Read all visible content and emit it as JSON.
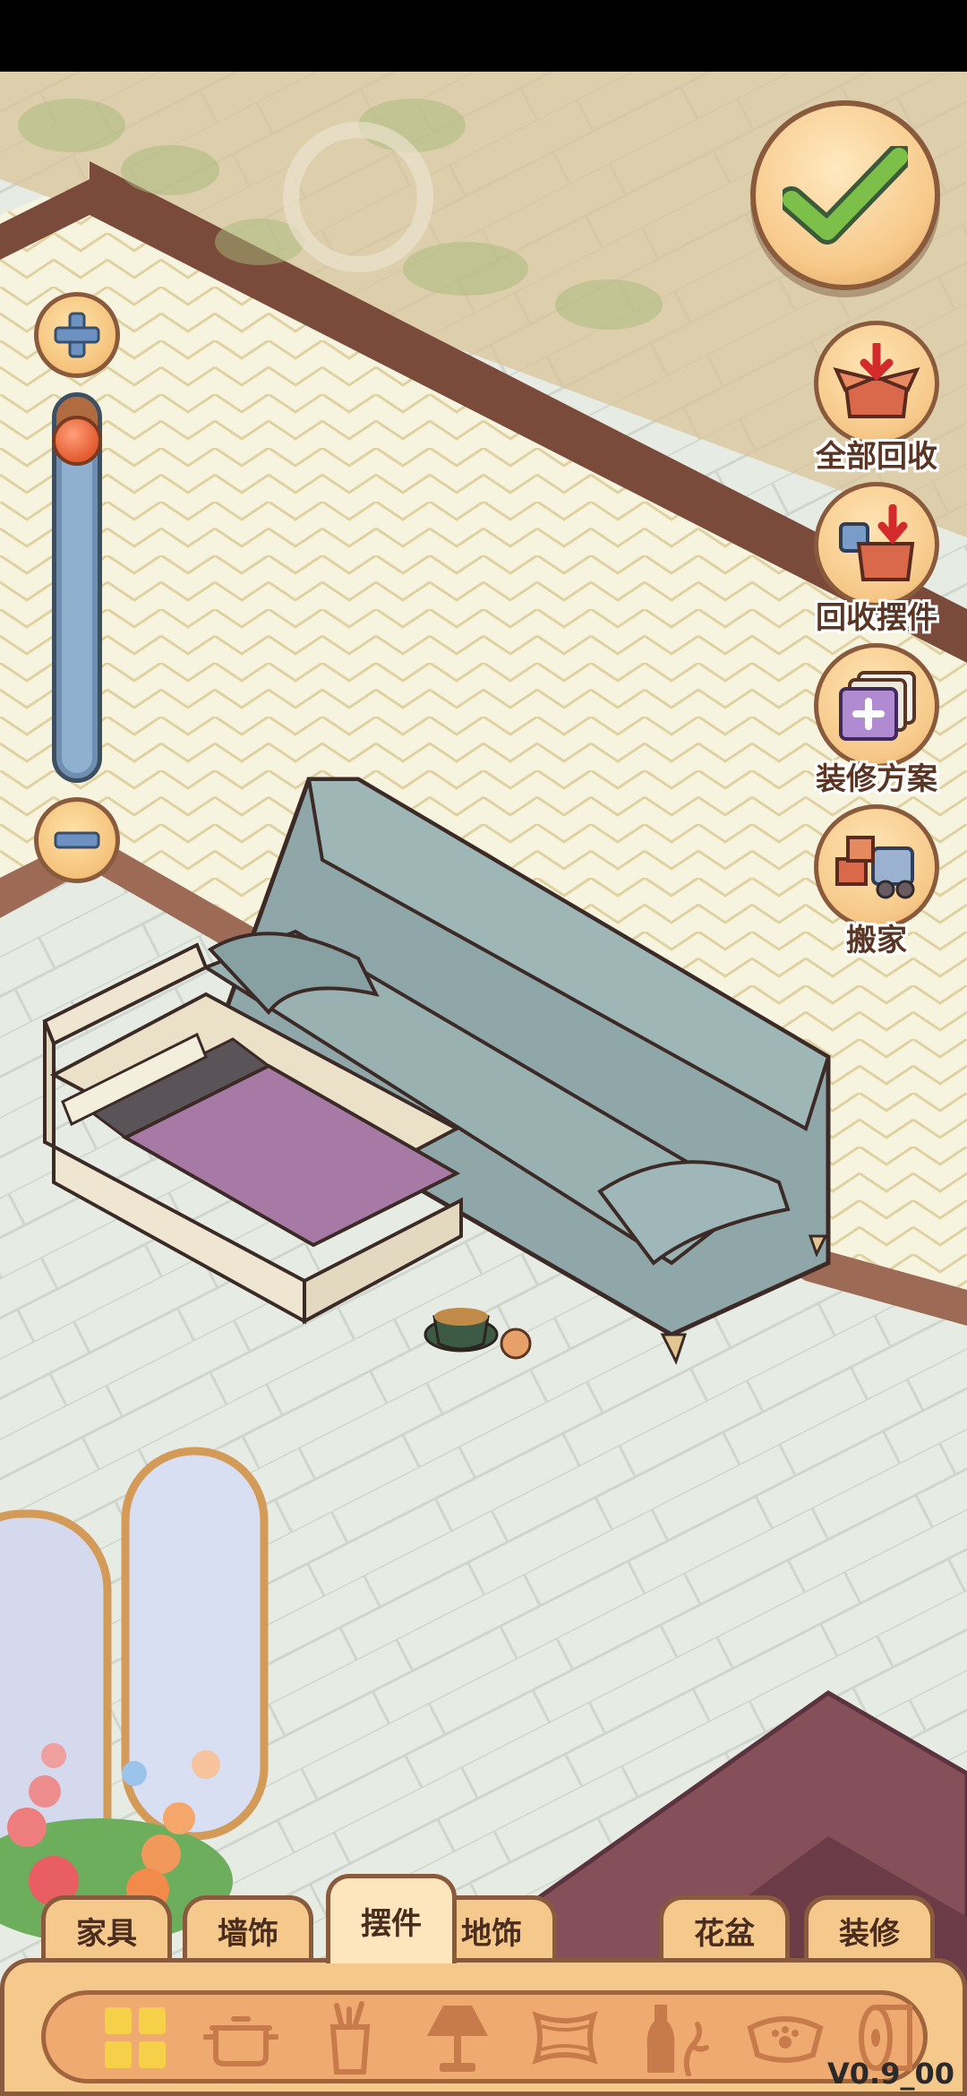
{
  "hud": {
    "zoom_in_icon": "plus-icon",
    "zoom_out_icon": "minus-icon",
    "zoom_level": 0.05,
    "confirm_icon": "checkmark-icon"
  },
  "side_actions": [
    {
      "label": "全部回收",
      "icon": "box-recycle-icon"
    },
    {
      "label": "回收摆件",
      "icon": "cup-box-recycle-icon"
    },
    {
      "label": "装修方案",
      "icon": "plan-cards-icon"
    },
    {
      "label": "搬家",
      "icon": "moving-truck-icon"
    }
  ],
  "tabs": [
    {
      "label": "家具",
      "active": false
    },
    {
      "label": "墙饰",
      "active": false
    },
    {
      "label": "摆件",
      "active": true
    },
    {
      "label": "地饰",
      "active": false
    },
    {
      "label": "花盆",
      "active": false
    },
    {
      "label": "装修",
      "active": false
    }
  ],
  "categories": [
    "grid-all-icon",
    "cookware-pot-icon",
    "cup-utensils-icon",
    "lamp-icon",
    "pillow-icon",
    "bottle-vase-icon",
    "pet-bowl-icon",
    "paper-roll-icon"
  ],
  "version": "V0.9_00",
  "colors": {
    "accent_orange": "#f5c98c",
    "outline_brown": "#8a5a3c",
    "sofa_teal": "#8fa7a8",
    "bed_purple": "#a77aa6",
    "zoom_blue": "#6e8fb2"
  }
}
